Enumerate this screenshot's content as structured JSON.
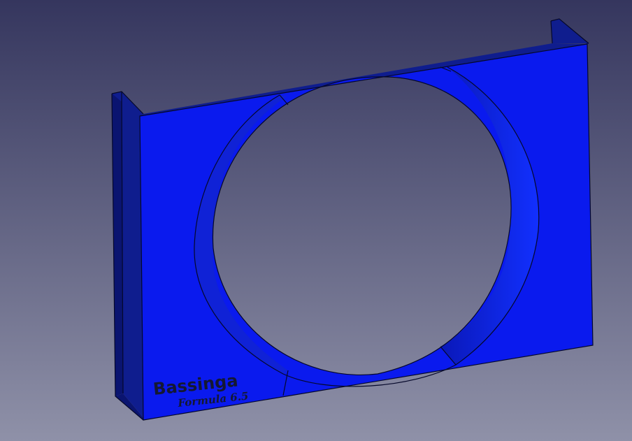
{
  "viewport": {
    "background_top": "#35365e",
    "background_bottom": "#8f91a8"
  },
  "part": {
    "face_color": "#0a1aee",
    "side_color": "#0f1d8e",
    "side_color_dark": "#0a1470",
    "inner_color": "#1022d6",
    "edge_color": "#05082a"
  },
  "engraving": {
    "title": "Bassinga",
    "subtitle": "Formula 6.5",
    "color": "#141833"
  }
}
